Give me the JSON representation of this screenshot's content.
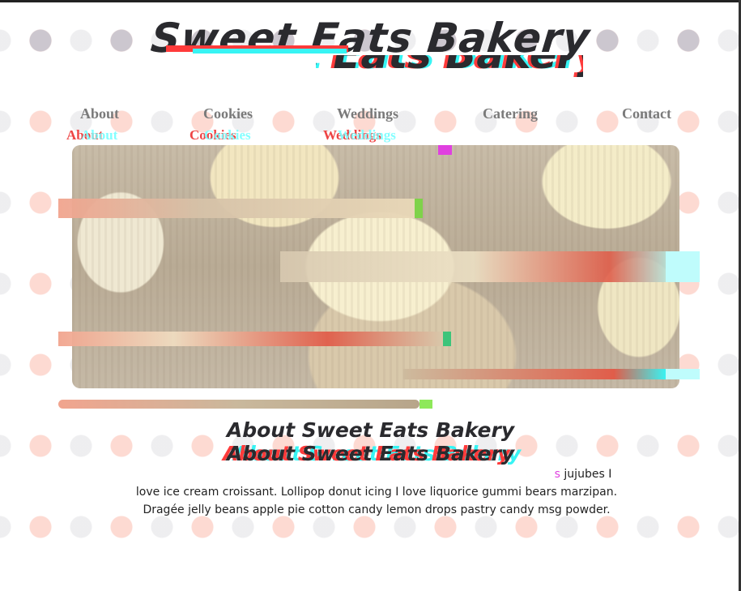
{
  "site": {
    "title": "Sweet Eats Bakery"
  },
  "nav": {
    "items": [
      {
        "label": "About"
      },
      {
        "label": "Cookies"
      },
      {
        "label": "Weddings"
      },
      {
        "label": "Catering"
      },
      {
        "label": "Contact"
      }
    ]
  },
  "hero": {
    "alt": "cupcakes"
  },
  "about": {
    "heading": "About Sweet Eats Bakery",
    "glitch_fragment": "s",
    "paragraph": "jujubes I love ice cream croissant. Lollipop donut icing I love liquorice gummi bears marzipan. Dragée jelly beans apple pie cotton candy lemon drops pastry candy msg powder."
  },
  "colors": {
    "glitch_red": "#ff3b3b",
    "glitch_cyan": "#37f4f4",
    "glitch_magenta": "#e040e0",
    "glitch_green": "#7fd24a",
    "title": "#2a2a2e",
    "nav": "#7a7a7a"
  }
}
